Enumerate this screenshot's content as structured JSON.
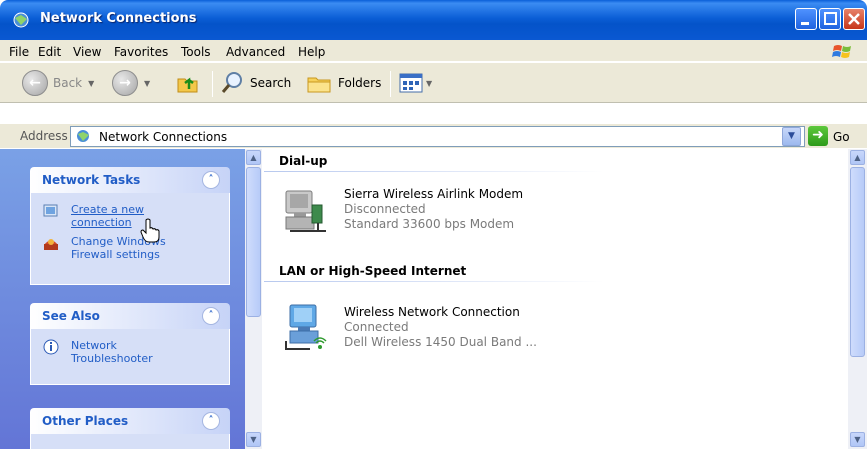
{
  "window": {
    "title": "Network Connections"
  },
  "menu": [
    "File",
    "Edit",
    "View",
    "Favorites",
    "Tools",
    "Advanced",
    "Help"
  ],
  "toolbar": {
    "back_label": "Back",
    "search_label": "Search",
    "folders_label": "Folders"
  },
  "address": {
    "label": "Address",
    "value": "Network Connections",
    "go_label": "Go"
  },
  "taskpane": {
    "network_tasks": {
      "title": "Network Tasks",
      "items": [
        {
          "label_1": "Create a new",
          "label_2": "connection"
        },
        {
          "label_1": "Change Windows",
          "label_2": "Firewall settings"
        }
      ]
    },
    "see_also": {
      "title": "See Also",
      "items": [
        {
          "label_1": "Network",
          "label_2": "Troubleshooter"
        }
      ]
    },
    "other_places": {
      "title": "Other Places"
    }
  },
  "groups": [
    {
      "title": "Dial-up",
      "connections": [
        {
          "name": "Sierra Wireless Airlink Modem",
          "status": "Disconnected",
          "device": "Standard 33600 bps Modem"
        }
      ]
    },
    {
      "title": "LAN or High-Speed Internet",
      "connections": [
        {
          "name": "Wireless Network Connection",
          "status": "Connected",
          "device": "Dell Wireless 1450 Dual Band ..."
        }
      ]
    }
  ],
  "colors": {
    "title_bar": "#0a58d2",
    "task_pane": "#7aa1e6",
    "link": "#215dc6"
  },
  "icons": [
    "network-connections-icon",
    "back-arrow-icon",
    "forward-arrow-icon",
    "up-folder-icon",
    "search-magnifier-icon",
    "folders-icon",
    "views-icon",
    "go-arrow-icon",
    "collapse-chevron-icon",
    "info-icon",
    "modem-computer-icon",
    "wireless-computer-icon",
    "hand-cursor-icon"
  ]
}
